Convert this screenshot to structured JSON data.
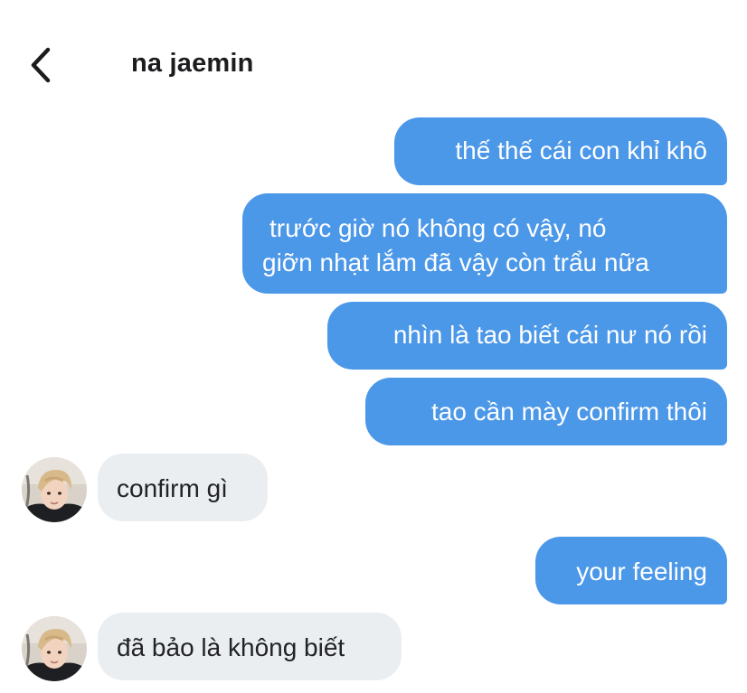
{
  "header": {
    "title": "na jaemin",
    "back_icon": "chevron-left-icon"
  },
  "colors": {
    "outgoing_bubble": "#4b97e8",
    "incoming_bubble": "#ebeef1"
  },
  "messages": [
    {
      "direction": "outgoing",
      "lines": [
        "thế thế cái con khỉ khô"
      ]
    },
    {
      "direction": "outgoing",
      "lines": [
        "trước giờ nó không có vậy, nó",
        "giỡn nhạt lắm đã vậy còn trẩu nữa"
      ]
    },
    {
      "direction": "outgoing",
      "lines": [
        "nhìn là tao biết cái nư nó rồi"
      ]
    },
    {
      "direction": "outgoing",
      "lines": [
        "tao cần mày confirm thôi"
      ]
    },
    {
      "direction": "incoming",
      "lines": [
        "confirm gì"
      ]
    },
    {
      "direction": "outgoing",
      "lines": [
        "your feeling"
      ]
    },
    {
      "direction": "incoming",
      "lines": [
        "đã bảo là không biết"
      ]
    }
  ]
}
